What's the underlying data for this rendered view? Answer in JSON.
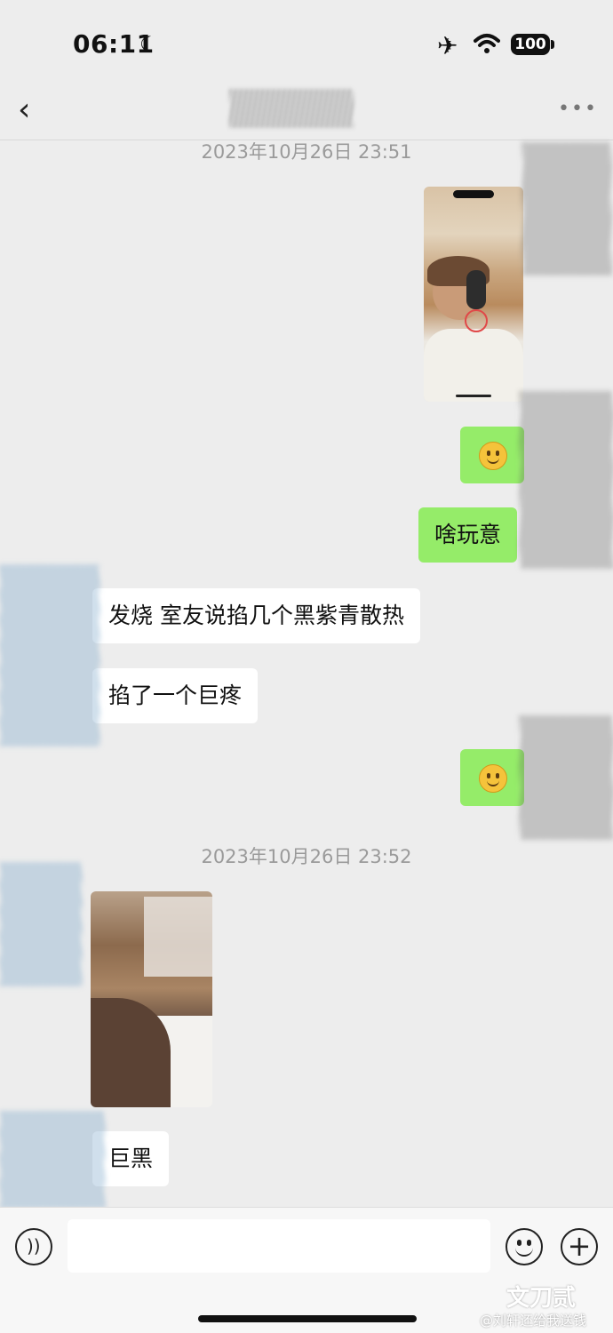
{
  "status_bar": {
    "time": "06:11",
    "battery": "100"
  },
  "nav": {
    "back_label": "‹",
    "more_label": "•••"
  },
  "messages": {
    "ts1": "2023年10月26日 23:51",
    "m_out_text": "啥玩意",
    "m_in_1": "发烧 室友说掐几个黑紫青散热",
    "m_in_2": "掐了一个巨疼",
    "ts2": "2023年10月26日 23:52",
    "m_in_3": "巨黑"
  },
  "input_bar": {
    "plus": "+"
  },
  "watermark": {
    "line1": "文刀贰",
    "line2": "@刘轩还给我送钱"
  },
  "colors": {
    "outgoing_bubble": "#95ec69",
    "incoming_bubble": "#ffffff",
    "background": "#ededed"
  }
}
